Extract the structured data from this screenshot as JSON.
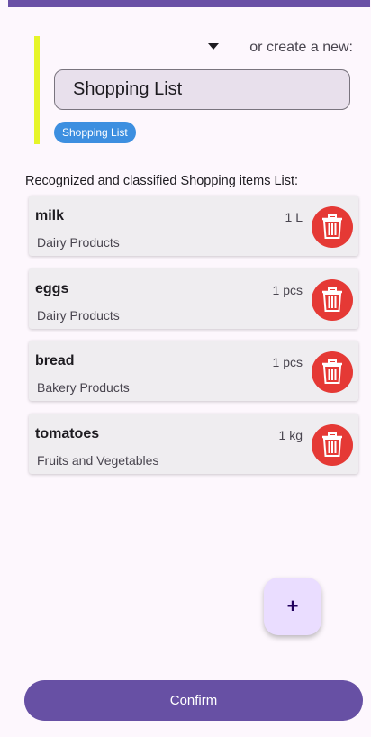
{
  "header": {
    "create_label": "or create a new:"
  },
  "list_name_input": {
    "value": "Shopping List"
  },
  "selected_list_chip": "Shopping List",
  "section_heading": "Recognized and classified Shopping items List:",
  "items": [
    {
      "name": "milk",
      "quantity": "1 L",
      "category": "Dairy Products"
    },
    {
      "name": "eggs",
      "quantity": "1 pcs",
      "category": "Dairy Products"
    },
    {
      "name": "bread",
      "quantity": "1 pcs",
      "category": "Bakery Products"
    },
    {
      "name": "tomatoes",
      "quantity": "1 kg",
      "category": "Fruits and Vegetables"
    }
  ],
  "fab_label": "+",
  "confirm_label": "Confirm",
  "colors": {
    "top_bar": "#6a50a6",
    "accent_line": "#e6f52a",
    "chip": "#3d8fe0",
    "delete": "#e53935",
    "fab": "#eaddff",
    "confirm": "#6750a4"
  },
  "icons": {
    "delete": "trash-icon",
    "dropdown": "dropdown-arrow-icon"
  }
}
